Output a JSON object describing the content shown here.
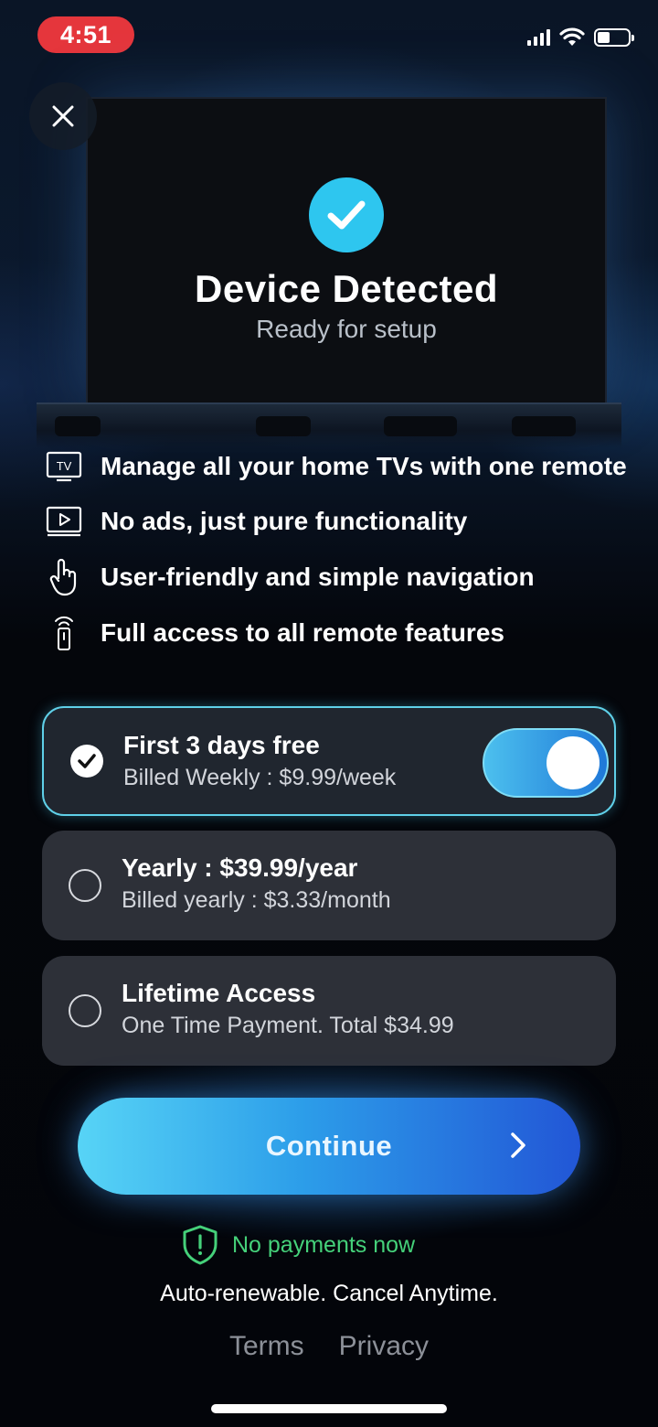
{
  "status_bar": {
    "time": "4:51"
  },
  "hero": {
    "title": "Device Detected",
    "subtitle": "Ready for setup"
  },
  "features": [
    {
      "icon": "tv-icon",
      "text": "Manage all your home TVs with one remote"
    },
    {
      "icon": "play-screen-icon",
      "text": "No ads, just pure functionality"
    },
    {
      "icon": "hand-pointer-icon",
      "text": "User-friendly and simple navigation"
    },
    {
      "icon": "remote-icon",
      "text": "Full access to all remote features"
    }
  ],
  "plans": [
    {
      "title": "First 3 days free",
      "subtitle": "Billed Weekly : $9.99/week",
      "selected": true,
      "trial_toggle_on": true
    },
    {
      "title": "Yearly : $39.99/year",
      "subtitle": "Billed yearly : $3.33/month",
      "selected": false
    },
    {
      "title": "Lifetime Access",
      "subtitle": "One Time Payment. Total $34.99",
      "selected": false
    }
  ],
  "cta": {
    "label": "Continue"
  },
  "no_payment": "No payments now",
  "renew_note": "Auto-renewable. Cancel Anytime.",
  "links": {
    "terms": "Terms",
    "privacy": "Privacy"
  },
  "colors": {
    "accent": "#2ec6ef",
    "success": "#45d17a",
    "time_pill": "#e5363c"
  }
}
